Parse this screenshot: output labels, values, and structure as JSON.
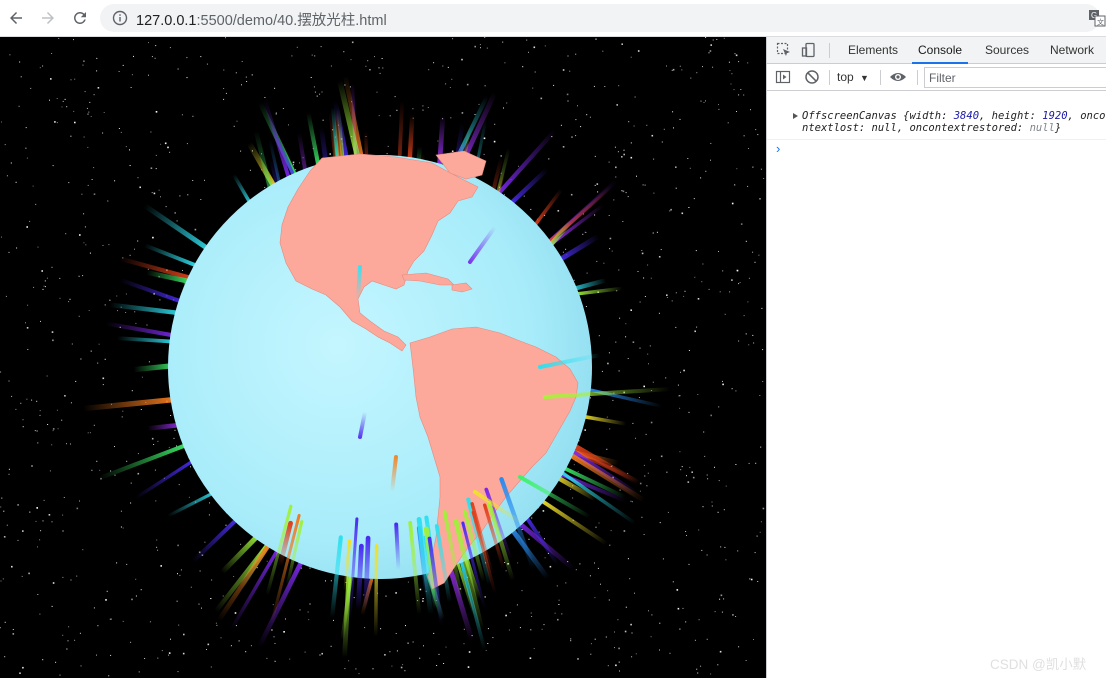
{
  "browser": {
    "url_host": "127.0.0.1",
    "url_path": ":5500/demo/40.摆放光柱.html",
    "icons": [
      "back-arrow-icon",
      "forward-arrow-icon",
      "reload-icon",
      "info-icon",
      "translate-icon"
    ]
  },
  "devtools": {
    "tabs": [
      "Elements",
      "Console",
      "Sources",
      "Network"
    ],
    "active_tab": "Console",
    "context": "top",
    "filter_placeholder": "Filter",
    "log": {
      "class_name": "OffscreenCanvas",
      "open": " {width: ",
      "width": "3840",
      "mid": ", height: ",
      "height": "1920",
      "rest": ", oncontextlost: null, oncontextrestored: ",
      "null_val": "null",
      "close": "}"
    }
  },
  "watermark": "CSDN @凯小默",
  "colors": {
    "ocean": "#a8ecfa",
    "land": "#fca89a",
    "space": "#000000",
    "accent": "#1a73e8"
  }
}
